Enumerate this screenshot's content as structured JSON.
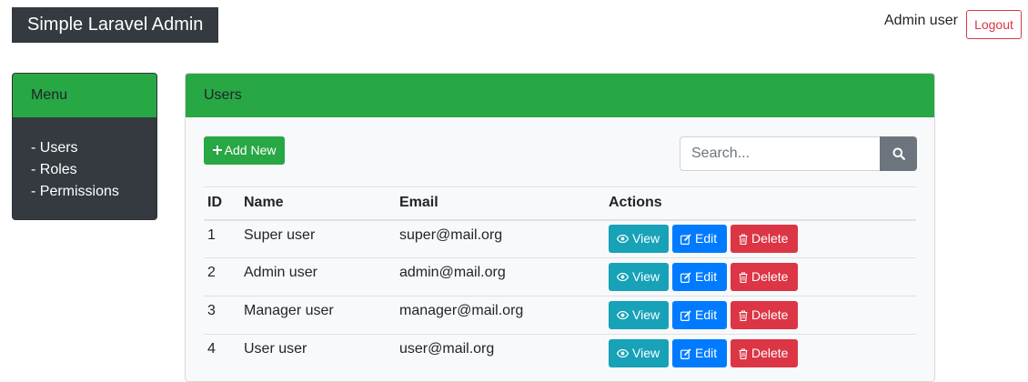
{
  "navbar": {
    "brand": "Simple Laravel Admin",
    "user_name": "Admin user",
    "logout_label": "Logout"
  },
  "menu": {
    "title": "Menu",
    "items": [
      {
        "label": "- Users"
      },
      {
        "label": "- Roles"
      },
      {
        "label": "- Permissions"
      }
    ]
  },
  "users_panel": {
    "title": "Users",
    "add_label": "Add New",
    "search_placeholder": "Search...",
    "columns": [
      "ID",
      "Name",
      "Email",
      "Actions"
    ],
    "rows": [
      {
        "id": "1",
        "name": "Super user",
        "email": "super@mail.org"
      },
      {
        "id": "2",
        "name": "Admin user",
        "email": "admin@mail.org"
      },
      {
        "id": "3",
        "name": "Manager user",
        "email": "manager@mail.org"
      },
      {
        "id": "4",
        "name": "User user",
        "email": "user@mail.org"
      }
    ],
    "actions": {
      "view": "View",
      "edit": "Edit",
      "delete": "Delete"
    }
  },
  "icons": {
    "add": "plus-icon",
    "search": "search-icon",
    "view": "eye-icon",
    "edit": "edit-icon",
    "delete": "trash-icon"
  },
  "colors": {
    "success": "#28a745",
    "dark": "#343a40",
    "info": "#17a2b8",
    "primary": "#007bff",
    "danger": "#dc3545",
    "secondary": "#6c757d"
  }
}
